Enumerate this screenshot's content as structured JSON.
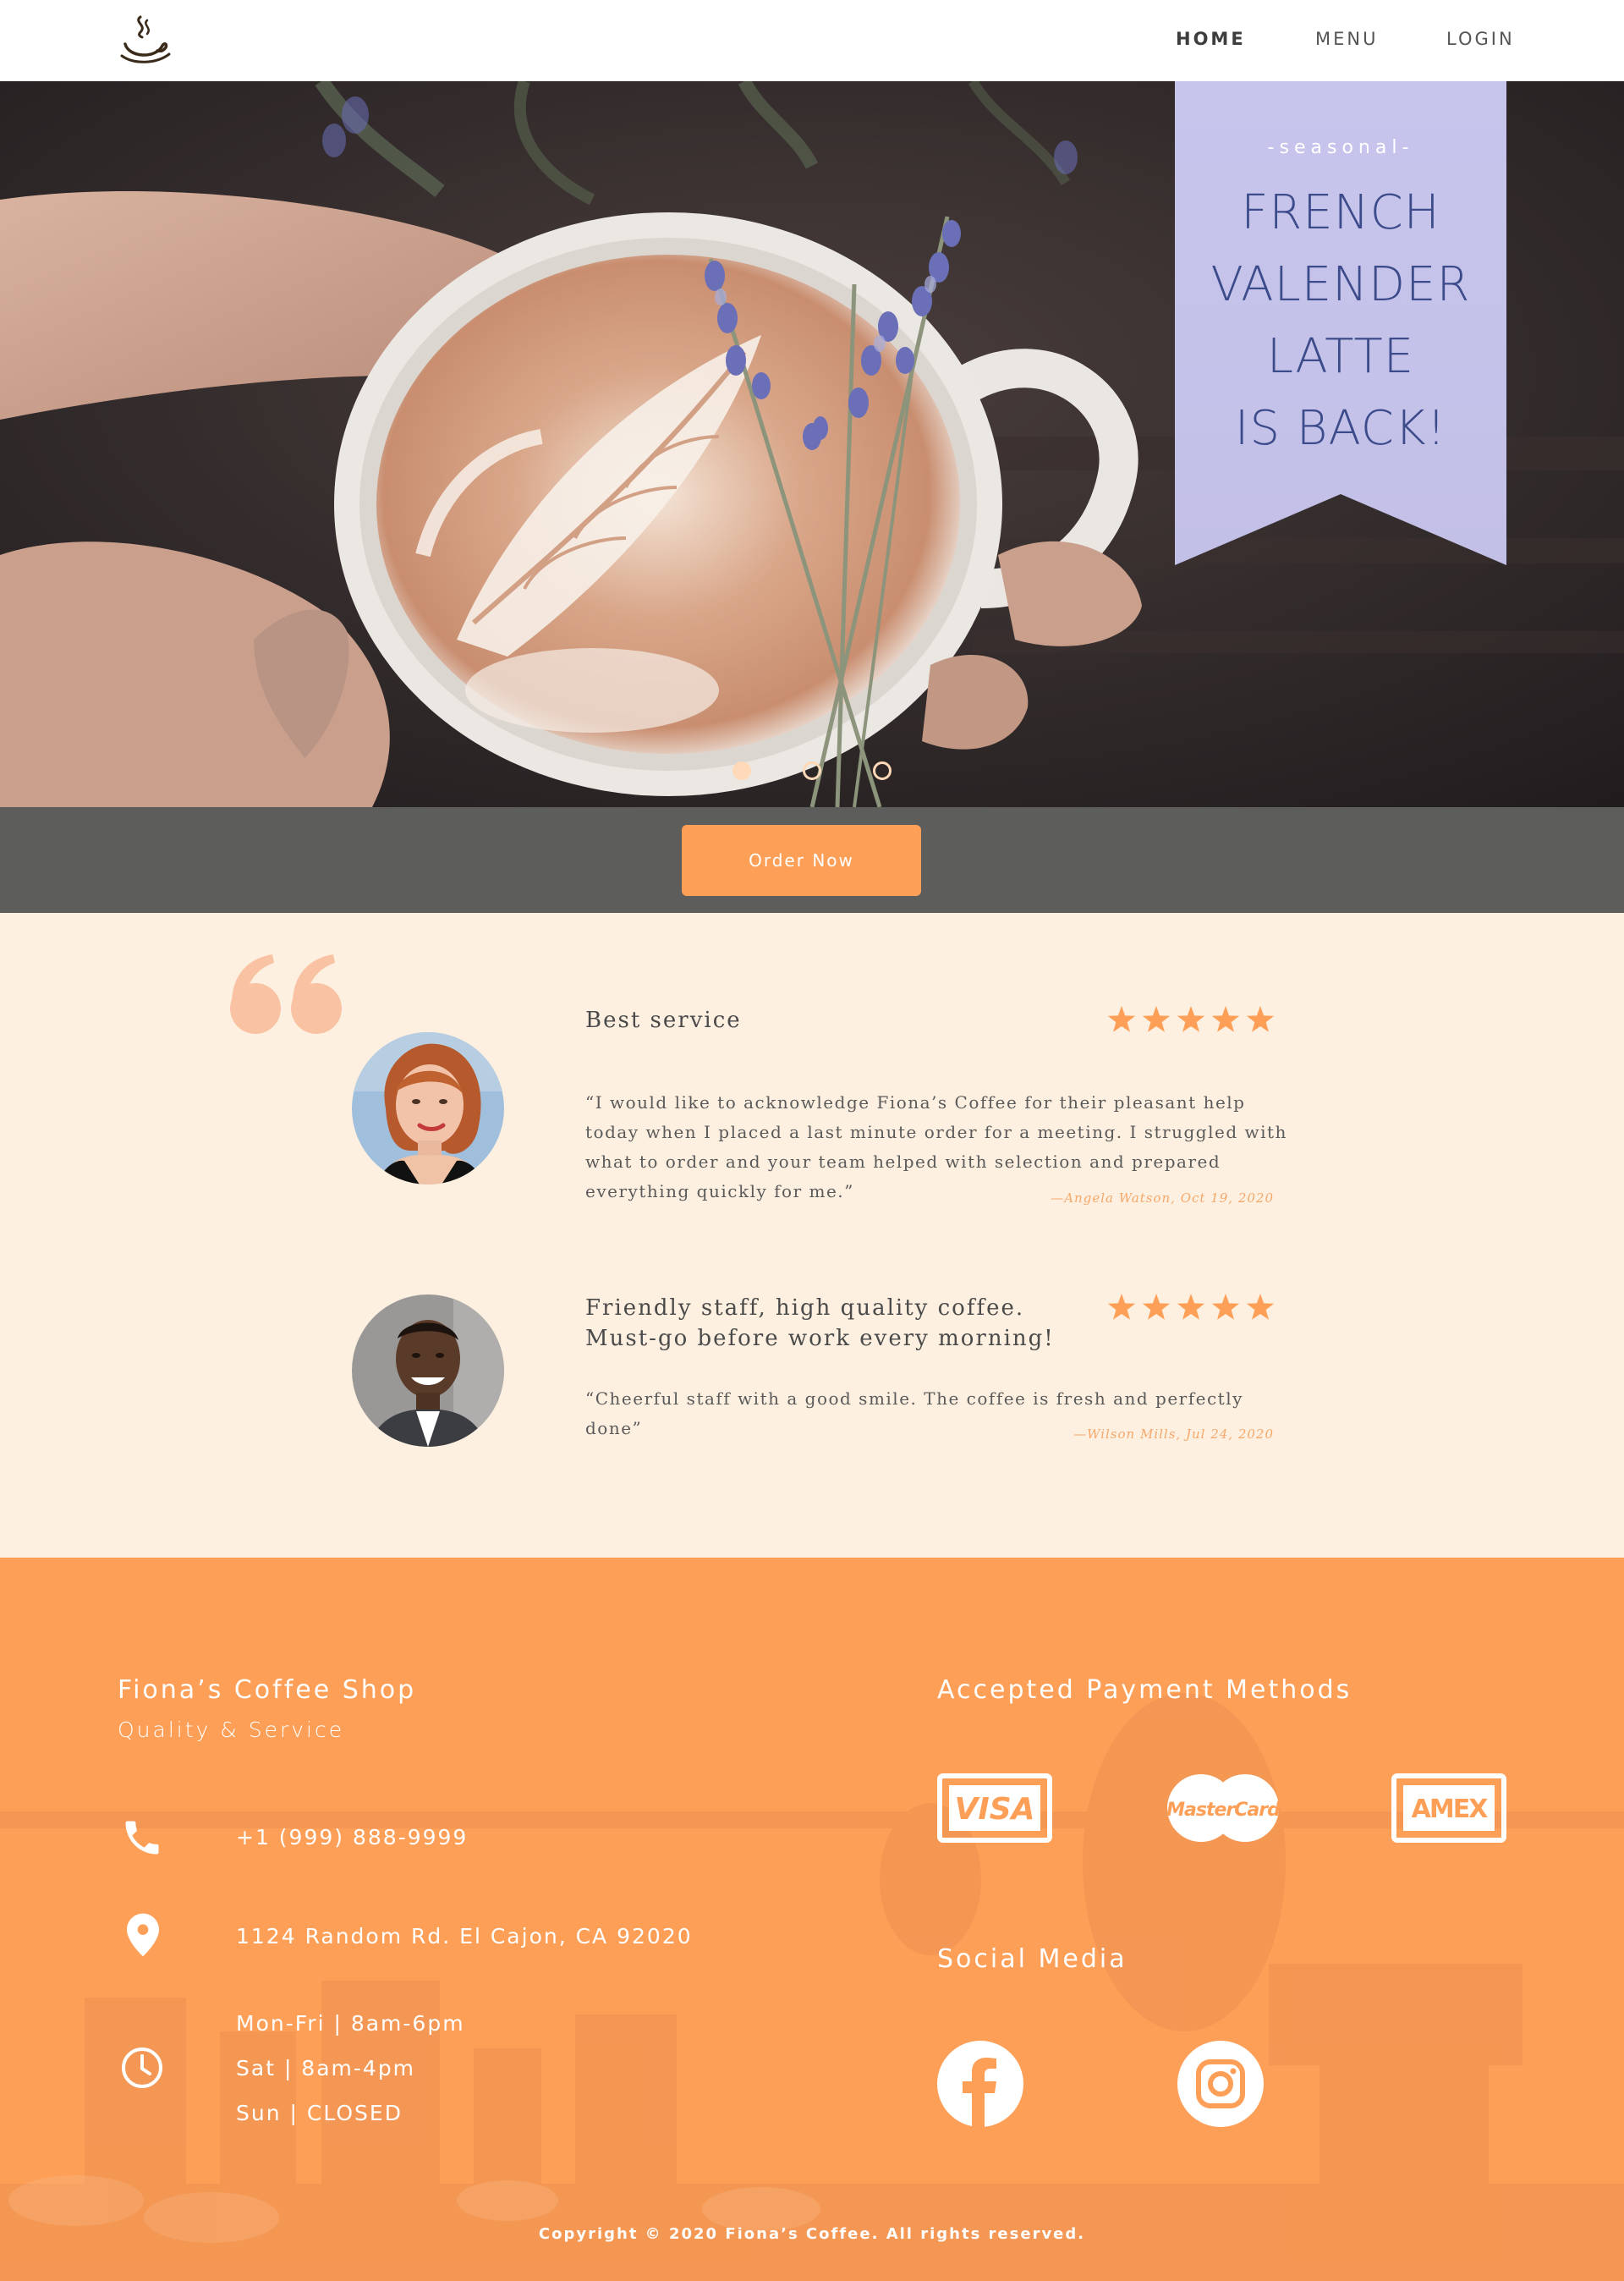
{
  "nav": {
    "logo_icon": "steaming-cup-icon",
    "links": [
      {
        "label": "HOME"
      },
      {
        "label": "MENU"
      },
      {
        "label": "LOGIN"
      }
    ],
    "active": "HOME"
  },
  "hero": {
    "banner": {
      "kicker": "-seasonal-",
      "lines": [
        "FRENCH",
        "VALENDER",
        "LATTE",
        "IS BACK!"
      ]
    },
    "carousel": {
      "slide_count": 3,
      "active_index": 0
    },
    "order_button_label": "Order Now"
  },
  "reviews": [
    {
      "title": "Best service",
      "rating": 5,
      "text": "“I would like to acknowledge Fiona’s Coffee for their pleasant help today when I placed a last minute order for a meeting. I struggled with what to order and your team helped with selection and prepared everything quickly for me.”",
      "author": "—Angela Watson,  Oct 19, 2020"
    },
    {
      "title": "Friendly staff, high quality coffee. Must-go before work every morning!",
      "rating": 5,
      "text": "“Cheerful staff with a good smile. The coffee is fresh and perfectly done”",
      "author": "—Wilson Mills,  Jul 24, 2020"
    }
  ],
  "footer": {
    "shop_name": "Fiona’s Coffee Shop",
    "tagline": "Quality & Service",
    "phone": "+1 (999) 888-9999",
    "address": "1124 Random Rd. El Cajon, CA 92020",
    "hours": [
      "Mon-Fri | 8am-6pm",
      "Sat | 8am-4pm",
      "Sun | CLOSED"
    ],
    "payment_heading": "Accepted Payment Methods",
    "payment_methods": [
      "VISA",
      "MasterCard",
      "AMEX"
    ],
    "social_heading": "Social Media",
    "social_links": [
      "facebook-icon",
      "instagram-icon"
    ],
    "copyright": "Copyright © 2020 Fiona’s Coffee. All rights reserved."
  },
  "colors": {
    "accent": "#fe9f58",
    "banner": "#c8c6eb",
    "banner_text": "#3c4b8a",
    "order_bar": "#5d5d5c",
    "testimonial_bg": "#fdf0e0"
  }
}
